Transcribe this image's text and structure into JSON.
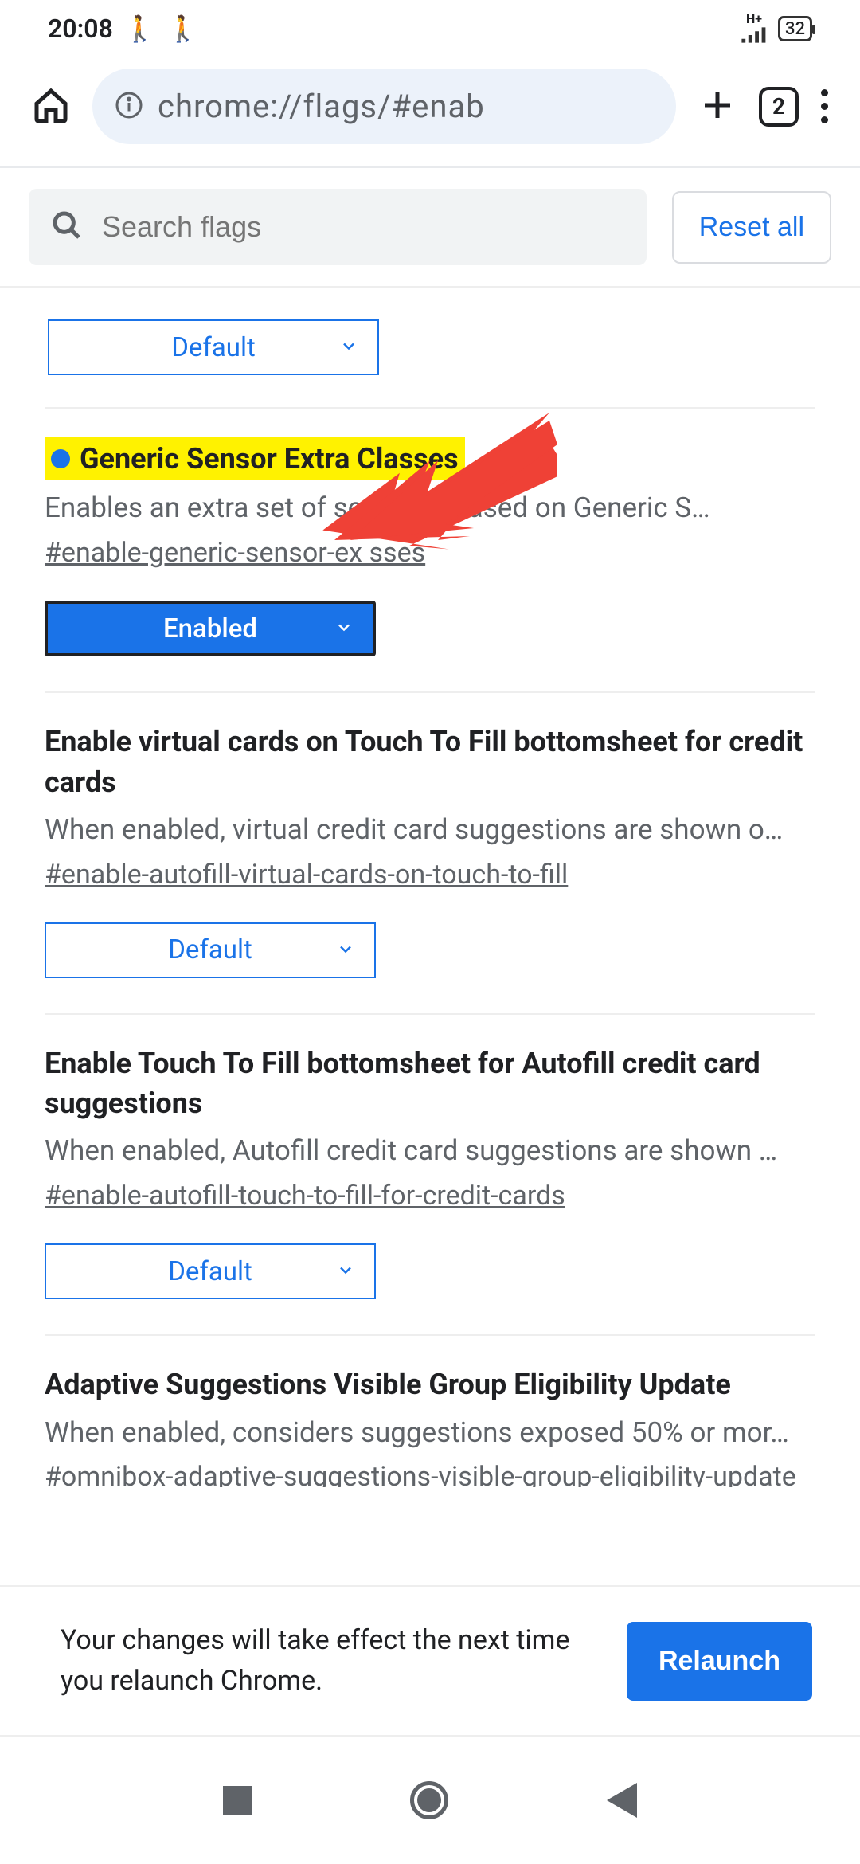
{
  "status": {
    "time": "20:08",
    "battery": "32",
    "network": "H+"
  },
  "browser": {
    "url": "chrome://flags/#enab",
    "tab_count": "2"
  },
  "search": {
    "placeholder": "Search flags",
    "reset_label": "Reset all"
  },
  "flags": [
    {
      "select_value": "Default"
    },
    {
      "title": "Generic Sensor Extra Classes",
      "desc": "Enables an extra set of sensor cla            ased on Generic S…",
      "hash": "#enable-generic-sensor-ex             sses",
      "select_value": "Enabled",
      "highlighted": true
    },
    {
      "title": "Enable virtual cards on Touch To Fill bottomsheet for credit cards",
      "desc": "When enabled, virtual credit card suggestions are shown o…",
      "hash": "#enable-autofill-virtual-cards-on-touch-to-fill",
      "select_value": "Default"
    },
    {
      "title": "Enable Touch To Fill bottomsheet for Autofill credit card suggestions",
      "desc": "When enabled, Autofill credit card suggestions are shown …",
      "hash": "#enable-autofill-touch-to-fill-for-credit-cards",
      "select_value": "Default"
    },
    {
      "title": "Adaptive Suggestions Visible Group Eligibility Update",
      "desc": "When enabled, considers suggestions exposed 50% or mor…",
      "hash": "#omnibox-adaptive-suggestions-visible-group-eligibility-update",
      "select_value": "Default"
    }
  ],
  "relaunch": {
    "message": "Your changes will take effect the next time you relaunch Chrome.",
    "button": "Relaunch"
  }
}
